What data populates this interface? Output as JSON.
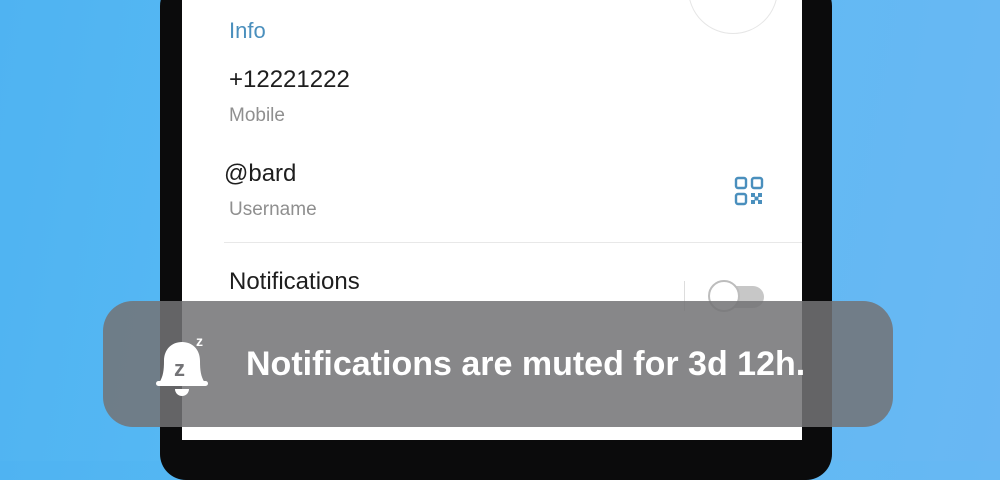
{
  "profile": {
    "section_title": "Info",
    "phone": {
      "value": "+12221222",
      "label": "Mobile"
    },
    "username": {
      "value": "@bard",
      "label": "Username"
    },
    "notifications": {
      "label": "Notifications",
      "enabled": false
    }
  },
  "toast": {
    "message": "Notifications are muted for 3d 12h.",
    "icon": "bell-snooze-icon"
  },
  "colors": {
    "accent": "#4a8fbd",
    "background_gradient_start": "#4fb3f2",
    "toast_background": "#737376"
  }
}
